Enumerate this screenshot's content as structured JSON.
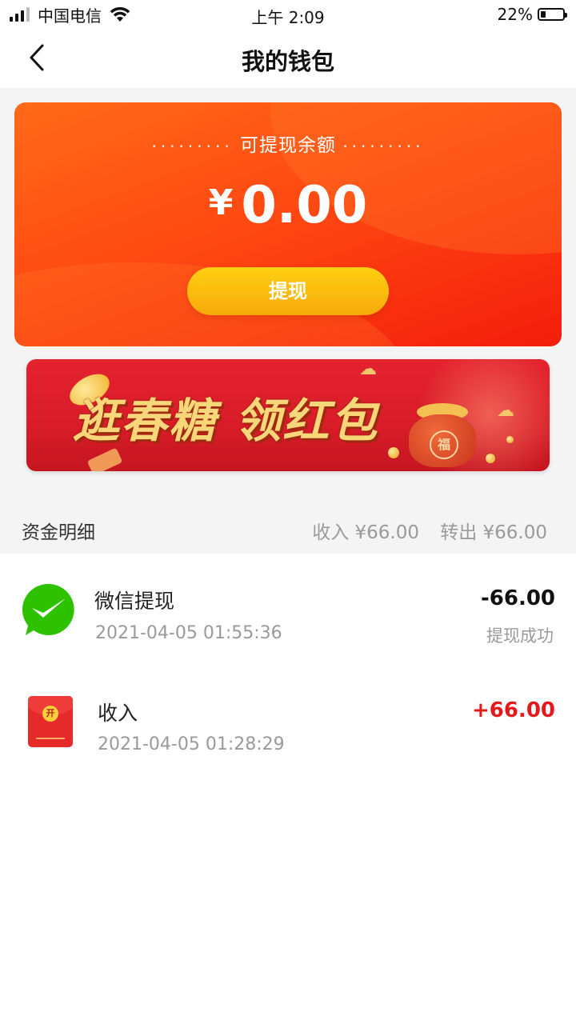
{
  "status_bar": {
    "carrier": "中国电信",
    "time": "上午 2:09",
    "battery": "22%",
    "battery_level": 0.22
  },
  "nav": {
    "title": "我的钱包",
    "back_icon": "chevron-left-icon"
  },
  "balance_card": {
    "label": "可提现余额",
    "dots": "·········",
    "currency": "¥",
    "amount": "0.00",
    "withdraw_button": "提现"
  },
  "banner": {
    "text": "逛春糖 领红包",
    "bag_mark": "福"
  },
  "summary": {
    "title": "资金明细",
    "income": "收入 ¥66.00",
    "transfer_out": "转出 ¥66.00"
  },
  "transactions": [
    {
      "icon": "wechat-icon",
      "title": "微信提现",
      "time": "2021-04-05 01:55:36",
      "amount": "-66.00",
      "status": "提现成功"
    },
    {
      "icon": "red-packet-icon",
      "title": "收入",
      "time": "2021-04-05 01:28:29",
      "amount": "+66.00",
      "seal": "开"
    }
  ],
  "colors": {
    "accent_orange": "#ff4a12",
    "button_yellow": "#f6a90b",
    "negative_amount": "#111111",
    "positive_amount": "#e3191c",
    "wechat_green": "#2dc100"
  }
}
